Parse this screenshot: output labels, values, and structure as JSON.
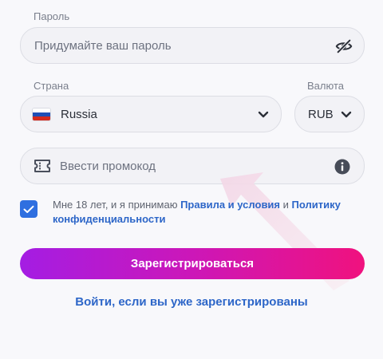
{
  "password": {
    "label": "Пароль",
    "placeholder": "Придумайте ваш пароль",
    "toggle_icon": "eye-off-icon"
  },
  "country": {
    "label": "Страна",
    "value": "Russia",
    "flag_icon": "flag-russia-icon"
  },
  "currency": {
    "label": "Валюта",
    "value": "RUB"
  },
  "promo": {
    "placeholder": "Ввести промокод",
    "ticket_icon": "ticket-icon",
    "info_icon": "info-icon"
  },
  "agreement": {
    "checked": true,
    "text_before": "Мне 18 лет, и я принимаю ",
    "terms_link": "Правила и условия",
    "text_middle": " и ",
    "privacy_link": "Политику конфиденциальности"
  },
  "submit_label": "Зарегистрироваться",
  "login_link": "Войти, если вы уже зарегистрированы",
  "colors": {
    "accent_blue": "#2d66c8",
    "checkbox": "#2f6fe0",
    "gradient_start": "#a41de3",
    "gradient_end": "#f0127e"
  }
}
